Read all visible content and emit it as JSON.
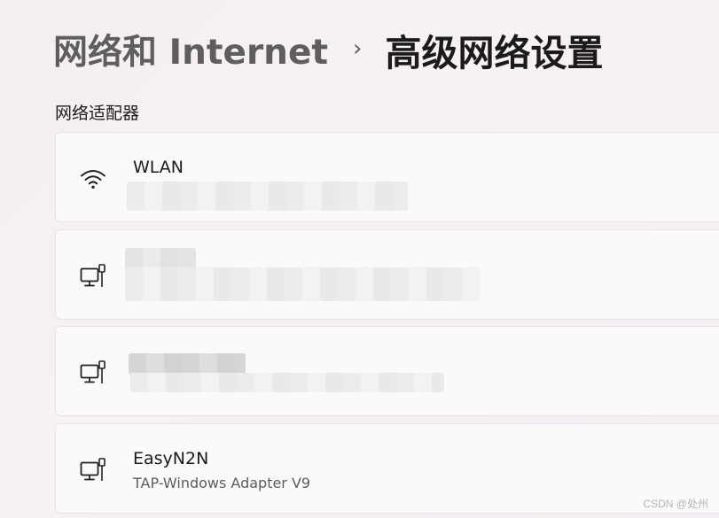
{
  "breadcrumb": {
    "parent": "网络和 Internet",
    "separator": "›",
    "current": "高级网络设置"
  },
  "section": {
    "title": "网络适配器"
  },
  "adapters": [
    {
      "name": "WLAN",
      "description": "",
      "icon": "wifi-icon"
    },
    {
      "name": "",
      "description": "",
      "icon": "ethernet-icon"
    },
    {
      "name": "",
      "description": "",
      "icon": "ethernet-icon"
    },
    {
      "name": "EasyN2N",
      "description": "TAP-Windows Adapter V9",
      "icon": "ethernet-icon"
    }
  ],
  "watermark": "CSDN @处州"
}
